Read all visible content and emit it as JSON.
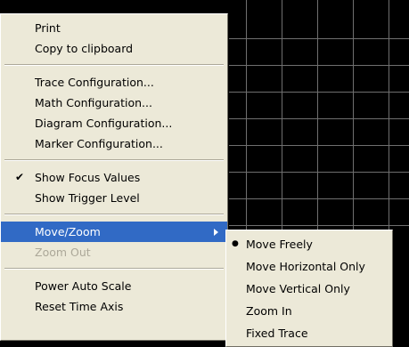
{
  "menu": {
    "groups": [
      [
        {
          "label": "Print"
        },
        {
          "label": "Copy to clipboard"
        }
      ],
      [
        {
          "label": "Trace Configuration..."
        },
        {
          "label": "Math Configuration..."
        },
        {
          "label": "Diagram Configuration..."
        },
        {
          "label": "Marker Configuration..."
        }
      ],
      [
        {
          "label": "Show Focus Values",
          "checked": true
        },
        {
          "label": "Show Trigger Level"
        }
      ],
      [
        {
          "label": "Move/Zoom",
          "active": true,
          "submenu": true
        },
        {
          "label": "Zoom Out",
          "disabled": true
        }
      ],
      [
        {
          "label": "Power Auto Scale"
        },
        {
          "label": "Reset Time Axis"
        }
      ]
    ]
  },
  "submenu": {
    "items": [
      {
        "label": "Move Freely",
        "selected": true
      },
      {
        "label": "Move Horizontal Only"
      },
      {
        "label": "Move Vertical Only"
      },
      {
        "label": "Zoom In"
      },
      {
        "label": "Fixed Trace"
      }
    ]
  },
  "icons": {
    "check": "checkmark-icon",
    "bullet": "radio-bullet-icon",
    "arrow": "submenu-arrow-icon"
  },
  "colors": {
    "highlight": "#316ac5",
    "menu_bg": "#ece9d8",
    "grid": "#6f6f6f",
    "background": "#000000"
  }
}
